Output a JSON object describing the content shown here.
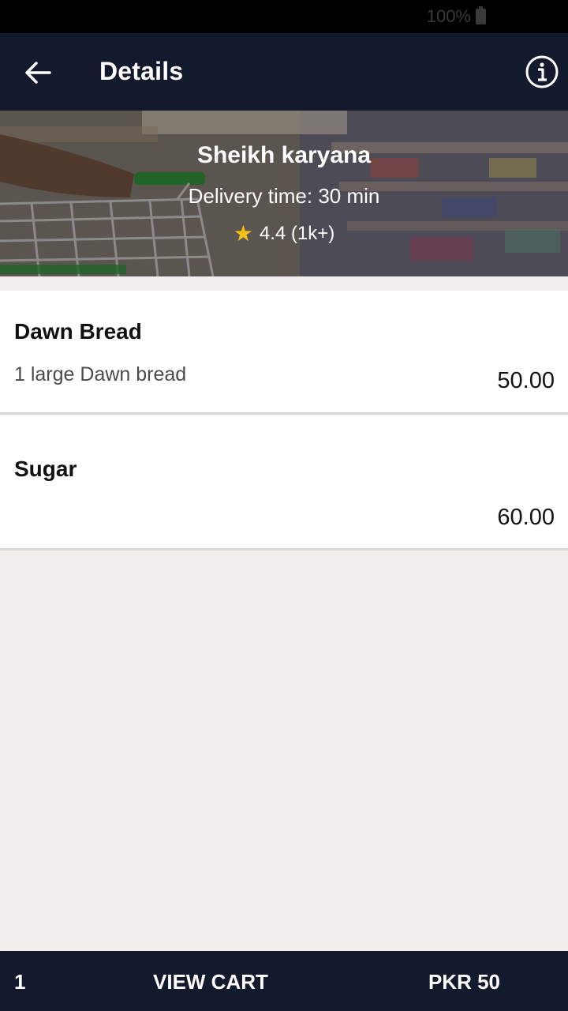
{
  "status_bar": {
    "battery": "100%"
  },
  "header": {
    "title": "Details"
  },
  "store": {
    "name": "Sheikh karyana",
    "delivery_time": "Delivery time: 30 min",
    "rating": "4.4 (1k+)"
  },
  "products": [
    {
      "name": "Dawn Bread",
      "description": "1 large Dawn bread",
      "price": "50.00"
    },
    {
      "name": "Sugar",
      "description": "",
      "price": "60.00"
    }
  ],
  "cart": {
    "count": "1",
    "label": "VIEW CART",
    "total": "PKR 50"
  },
  "colors": {
    "header_bg": "#141a2e",
    "accent_star": "#f5c01a",
    "page_bg": "#f3efee"
  }
}
